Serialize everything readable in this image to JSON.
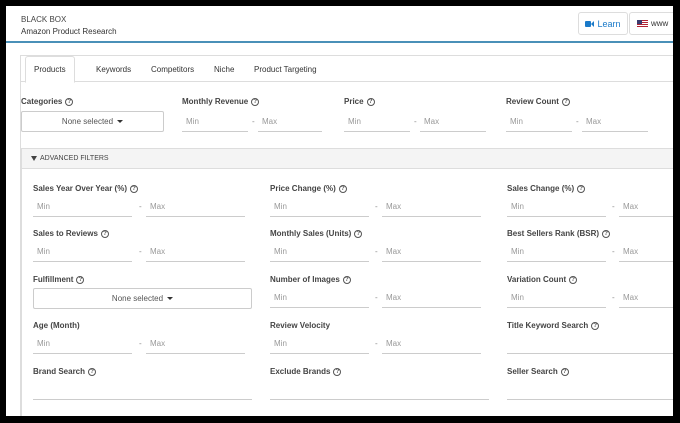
{
  "header": {
    "brand_line1": "BLACK BOX",
    "brand_line2": "Amazon Product Research",
    "learn_label": "Learn",
    "marketplace_label": "www"
  },
  "tabs": [
    {
      "label": "Products",
      "active": true
    },
    {
      "label": "Keywords"
    },
    {
      "label": "Competitors"
    },
    {
      "label": "Niche"
    },
    {
      "label": "Product Targeting"
    }
  ],
  "top_filters": {
    "categories": {
      "label": "Categories",
      "value": "None selected"
    },
    "monthly_revenue": {
      "label": "Monthly Revenue",
      "min": "Min",
      "max": "Max"
    },
    "price": {
      "label": "Price",
      "min": "Min",
      "max": "Max"
    },
    "review_count": {
      "label": "Review Count",
      "min": "Min",
      "max": "Max"
    }
  },
  "advanced": {
    "title": "ADVANCED FILTERS",
    "sales_yoy": {
      "label": "Sales Year Over Year (%)",
      "min": "Min",
      "max": "Max"
    },
    "price_change": {
      "label": "Price Change (%)",
      "min": "Min",
      "max": "Max"
    },
    "sales_change": {
      "label": "Sales Change (%)",
      "min": "Min",
      "max": "Max"
    },
    "sales_to_reviews": {
      "label": "Sales to Reviews",
      "min": "Min",
      "max": "Max"
    },
    "monthly_sales": {
      "label": "Monthly Sales (Units)",
      "min": "Min",
      "max": "Max"
    },
    "bsr": {
      "label": "Best Sellers Rank (BSR)",
      "min": "Min",
      "max": "Max"
    },
    "fulfillment": {
      "label": "Fulfillment",
      "value": "None selected"
    },
    "num_images": {
      "label": "Number of Images",
      "min": "Min",
      "max": "Max"
    },
    "variation_count": {
      "label": "Variation Count",
      "min": "Min",
      "max": "Max"
    },
    "age": {
      "label": "Age (Month)",
      "min": "Min",
      "max": "Max"
    },
    "review_velocity": {
      "label": "Review Velocity",
      "min": "Min",
      "max": "Max"
    },
    "title_keyword": {
      "label": "Title Keyword Search"
    },
    "brand_search": {
      "label": "Brand Search"
    },
    "exclude_brands": {
      "label": "Exclude Brands"
    },
    "seller_search": {
      "label": "Seller Search"
    }
  },
  "separator": "-",
  "help_glyph": "?"
}
